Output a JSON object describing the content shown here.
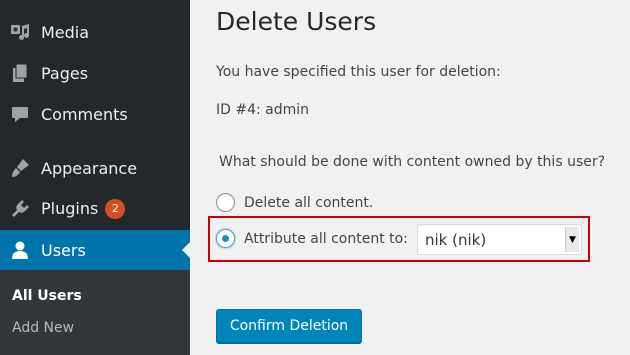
{
  "sidebar": {
    "items": [
      {
        "label": "Media",
        "icon": "media-icon"
      },
      {
        "label": "Pages",
        "icon": "pages-icon"
      },
      {
        "label": "Comments",
        "icon": "comments-icon"
      },
      {
        "label": "Appearance",
        "icon": "appearance-icon"
      },
      {
        "label": "Plugins",
        "icon": "plugins-icon",
        "badge": "2"
      },
      {
        "label": "Users",
        "icon": "users-icon",
        "active": true
      }
    ],
    "submenu": [
      {
        "label": "All Users",
        "current": true
      },
      {
        "label": "Add New"
      }
    ]
  },
  "main": {
    "title": "Delete Users",
    "specified_text": "You have specified this user for deletion:",
    "user_id_text": "ID #4: admin",
    "question": "What should be done with content owned by this user?",
    "options": [
      {
        "label": "Delete all content.",
        "checked": false
      },
      {
        "label": "Attribute all content to:",
        "checked": true
      }
    ],
    "select_value": "nik (nik)",
    "confirm_label": "Confirm Deletion"
  },
  "colors": {
    "sidebar_bg": "#23282d",
    "active_bg": "#0073aa",
    "button_bg": "#0085ba",
    "badge_bg": "#d54e21",
    "highlight_border": "#cc0000"
  }
}
